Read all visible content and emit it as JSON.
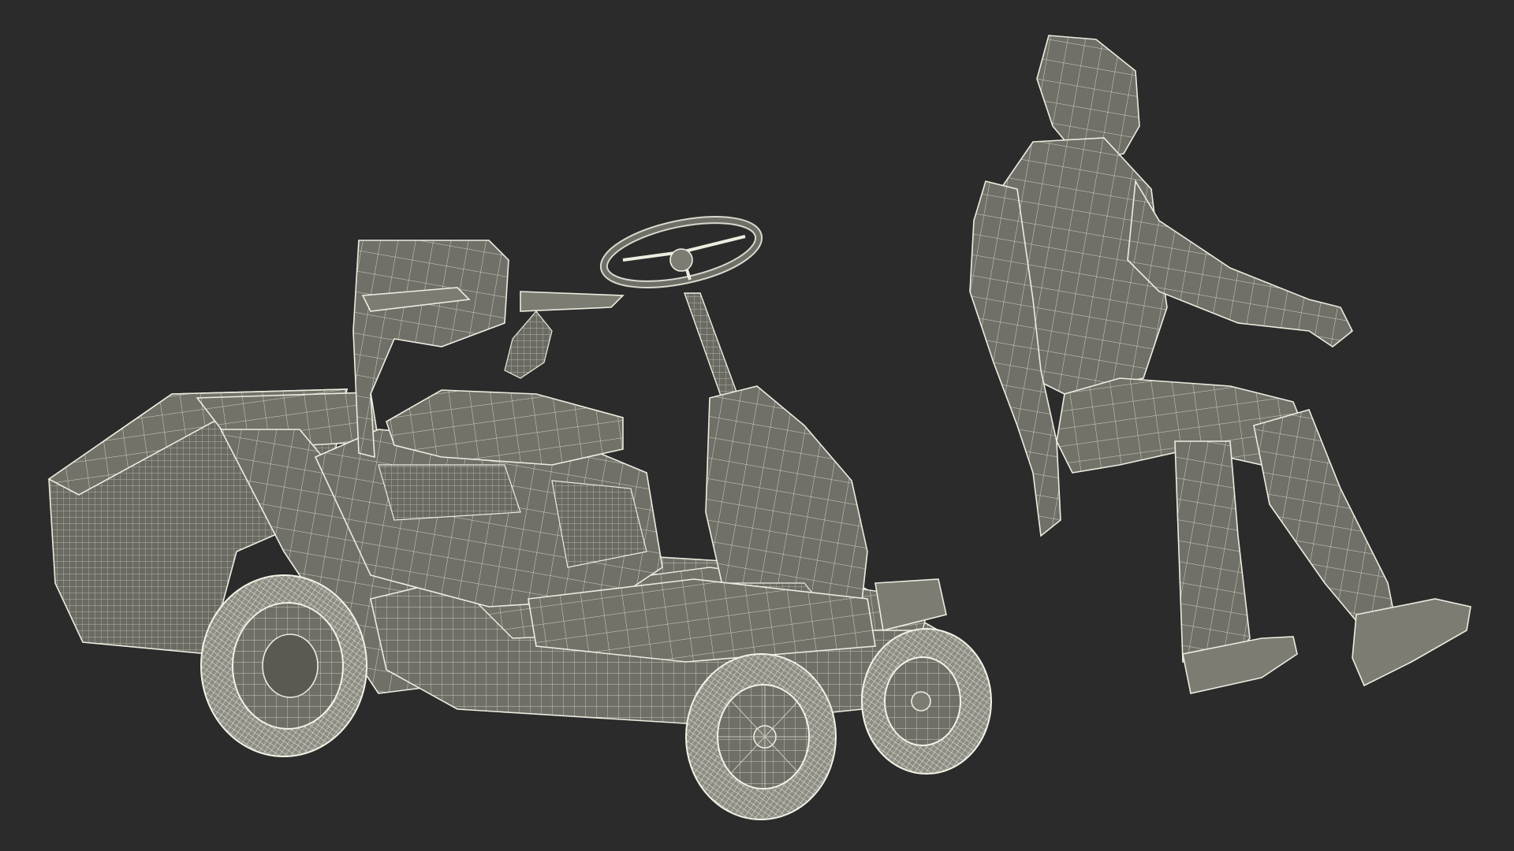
{
  "scene": {
    "background_color": "#2b2b2b",
    "mesh_fill_color": "#6f6f67",
    "wireframe_color": "#ecece0",
    "objects": [
      {
        "id": "riding-mower",
        "icon": "riding-lawn-mower-wireframe"
      },
      {
        "id": "seated-man",
        "icon": "seated-man-wireframe"
      }
    ]
  }
}
